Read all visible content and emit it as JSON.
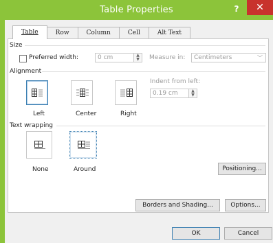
{
  "window": {
    "title": "Table Properties",
    "help": "?",
    "close": "✕"
  },
  "tabs": [
    {
      "label": "Table",
      "active": true
    },
    {
      "label": "Row"
    },
    {
      "label": "Column"
    },
    {
      "label": "Cell"
    },
    {
      "label": "Alt Text"
    }
  ],
  "size": {
    "group_label": "Size",
    "preferred_width_label": "Preferred width:",
    "preferred_width_value": "0 cm",
    "measure_in_label": "Measure in:",
    "measure_in_value": "Centimeters"
  },
  "alignment": {
    "group_label": "Alignment",
    "options": [
      "Left",
      "Center",
      "Right"
    ],
    "indent_label": "Indent from left:",
    "indent_value": "0.19 cm"
  },
  "wrapping": {
    "group_label": "Text wrapping",
    "options": [
      "None",
      "Around"
    ],
    "positioning_button": "Positioning..."
  },
  "buttons": {
    "borders": "Borders and Shading...",
    "options": "Options...",
    "ok": "OK",
    "cancel": "Cancel"
  }
}
